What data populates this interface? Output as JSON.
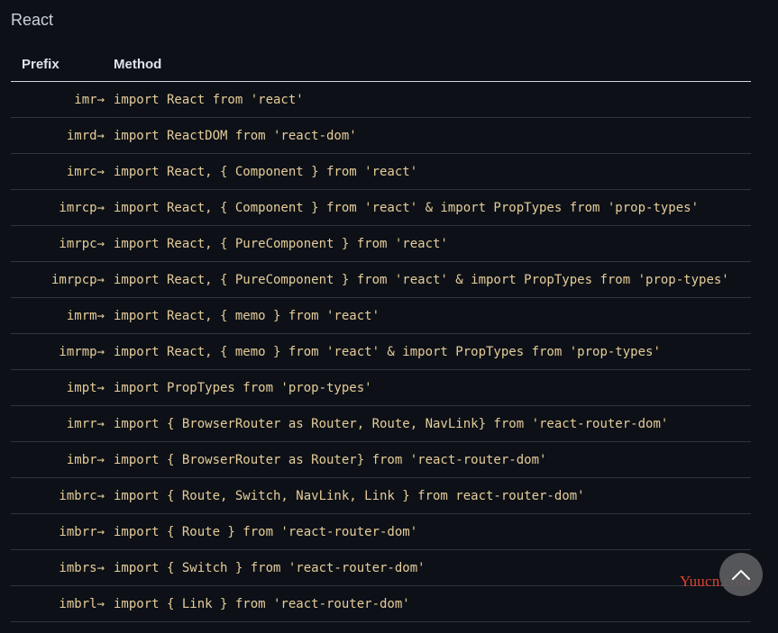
{
  "section": {
    "title": "React"
  },
  "table": {
    "headers": {
      "prefix": "Prefix",
      "method": "Method"
    },
    "rows": [
      {
        "prefix": "imr→",
        "method": "import React from 'react'"
      },
      {
        "prefix": "imrd→",
        "method": "import ReactDOM from 'react-dom'"
      },
      {
        "prefix": "imrc→",
        "method": "import React, { Component } from 'react'"
      },
      {
        "prefix": "imrcp→",
        "method": "import React, { Component } from 'react' & import PropTypes from 'prop-types'"
      },
      {
        "prefix": "imrpc→",
        "method": "import React, { PureComponent } from 'react'"
      },
      {
        "prefix": "imrpcp→",
        "method": "import React, { PureComponent } from 'react' & import PropTypes from 'prop-types'"
      },
      {
        "prefix": "imrm→",
        "method": "import React, { memo } from 'react'"
      },
      {
        "prefix": "imrmp→",
        "method": "import React, { memo } from 'react' & import PropTypes from 'prop-types'"
      },
      {
        "prefix": "impt→",
        "method": "import PropTypes from 'prop-types'"
      },
      {
        "prefix": "imrr→",
        "method": "import { BrowserRouter as Router, Route, NavLink} from 'react-router-dom'"
      },
      {
        "prefix": "imbr→",
        "method": "import { BrowserRouter as Router} from 'react-router-dom'"
      },
      {
        "prefix": "imbrc→",
        "method": "import { Route, Switch, NavLink, Link } from react-router-dom'"
      },
      {
        "prefix": "imbrr→",
        "method": "import { Route } from 'react-router-dom'"
      },
      {
        "prefix": "imbrs→",
        "method": "import { Switch } from 'react-router-dom'"
      },
      {
        "prefix": "imbrl→",
        "method": "import { Link } from 'react-router-dom'"
      }
    ]
  },
  "scroll_top": {
    "icon": "chevron-up-icon"
  },
  "watermark": {
    "text": "Yuucn.com"
  },
  "colors": {
    "background": "#0d1117",
    "code_text": "#e6cc9a",
    "watermark": "#e0402f"
  }
}
